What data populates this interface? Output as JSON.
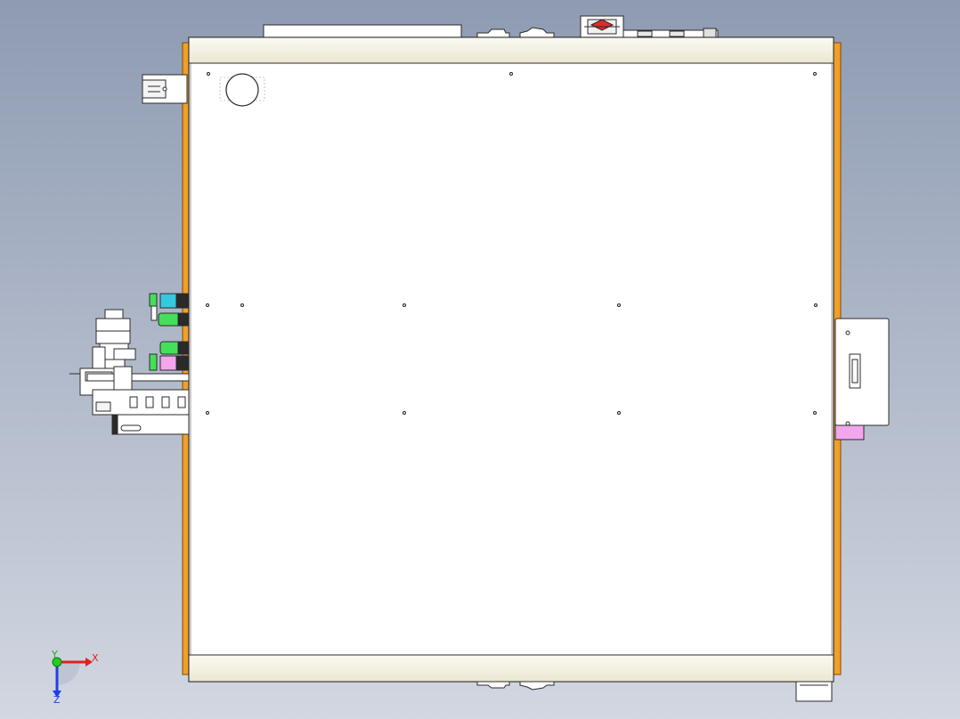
{
  "viewport": {
    "background_top": "#8e9bb2",
    "background_bottom": "#d2d7e1"
  },
  "colors": {
    "panel_fill": "#ffffff",
    "rail_fill": "#f5f3e6",
    "side_rail": "#f0a028",
    "outline": "#2b2b2b",
    "accent_cyan": "#33c9e0",
    "accent_green": "#44e05a",
    "accent_pink": "#f2a6ee",
    "accent_red": "#e02a2a",
    "axis_x": "#e02020",
    "axis_y": "#22cc22",
    "axis_z": "#2040e0"
  },
  "triad": {
    "x_label": "X",
    "y_label": "Y",
    "z_label": "Z"
  },
  "icons": {
    "triad": "coordinate-triad-icon",
    "sensor": "round-sensor-icon"
  }
}
